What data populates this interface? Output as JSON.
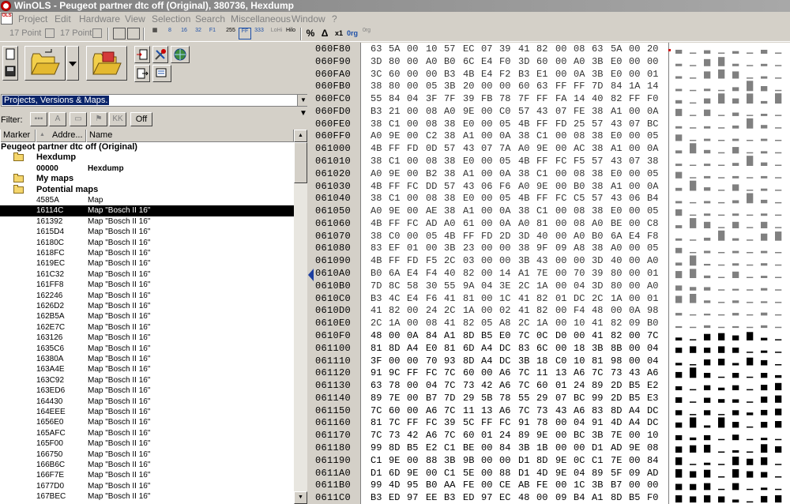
{
  "window": {
    "title": "WinOLS - Peugeot partner dtc off (Original), 380736, Hexdump"
  },
  "menu": [
    "Project",
    "Edit",
    "Hardware",
    "View",
    "Selection",
    "Search",
    "Miscellaneous",
    "Window",
    "?"
  ],
  "toolbar": {
    "point_a": "17 Point",
    "point_b": "17 Point",
    "labels": [
      "8",
      "16",
      "32",
      "F1",
      "255",
      "FF",
      "333",
      "LoHi",
      "Hilo",
      "%",
      "Δ",
      "x1",
      "0rg",
      "0rg"
    ]
  },
  "combo": {
    "value": "Projects, Versions & Maps."
  },
  "filter": {
    "label": "Filter:",
    "off_label": "Off"
  },
  "columns": [
    "Marker",
    "Addre...",
    "Name"
  ],
  "tree": [
    {
      "label": "Peugeot partner dtc off (Original)",
      "kind": "root"
    },
    {
      "label": "Hexdump",
      "kind": "folder"
    },
    {
      "addr": "00000",
      "name": "Hexdump",
      "kind": "boldleaf"
    },
    {
      "label": "My maps",
      "kind": "folder"
    },
    {
      "label": "Potential maps",
      "kind": "folder"
    },
    {
      "addr": "4585A",
      "name": "Map",
      "kind": "leaf"
    },
    {
      "addr": "16114C",
      "name": "Map \"Bosch II 16\"",
      "kind": "leaf",
      "selected": true
    },
    {
      "addr": "161392",
      "name": "Map \"Bosch II 16\"",
      "kind": "leaf"
    },
    {
      "addr": "1615D4",
      "name": "Map \"Bosch II 16\"",
      "kind": "leaf"
    },
    {
      "addr": "16180C",
      "name": "Map \"Bosch II 16\"",
      "kind": "leaf"
    },
    {
      "addr": "1618FC",
      "name": "Map \"Bosch II 16\"",
      "kind": "leaf"
    },
    {
      "addr": "1619EC",
      "name": "Map \"Bosch II 16\"",
      "kind": "leaf"
    },
    {
      "addr": "161C32",
      "name": "Map \"Bosch II 16\"",
      "kind": "leaf"
    },
    {
      "addr": "161FF8",
      "name": "Map \"Bosch II 16\"",
      "kind": "leaf"
    },
    {
      "addr": "162246",
      "name": "Map \"Bosch II 16\"",
      "kind": "leaf"
    },
    {
      "addr": "1626D2",
      "name": "Map \"Bosch II 16\"",
      "kind": "leaf"
    },
    {
      "addr": "162B5A",
      "name": "Map \"Bosch II 16\"",
      "kind": "leaf"
    },
    {
      "addr": "162E7C",
      "name": "Map \"Bosch II 16\"",
      "kind": "leaf"
    },
    {
      "addr": "163126",
      "name": "Map \"Bosch II 16\"",
      "kind": "leaf"
    },
    {
      "addr": "1635C6",
      "name": "Map \"Bosch II 16\"",
      "kind": "leaf"
    },
    {
      "addr": "16380A",
      "name": "Map \"Bosch II 16\"",
      "kind": "leaf"
    },
    {
      "addr": "163A4E",
      "name": "Map \"Bosch II 16\"",
      "kind": "leaf"
    },
    {
      "addr": "163C92",
      "name": "Map \"Bosch II 16\"",
      "kind": "leaf"
    },
    {
      "addr": "163ED6",
      "name": "Map \"Bosch II 16\"",
      "kind": "leaf"
    },
    {
      "addr": "164430",
      "name": "Map \"Bosch II 16\"",
      "kind": "leaf"
    },
    {
      "addr": "164EEE",
      "name": "Map \"Bosch II 16\"",
      "kind": "leaf"
    },
    {
      "addr": "1656E0",
      "name": "Map \"Bosch II 16\"",
      "kind": "leaf"
    },
    {
      "addr": "165AFC",
      "name": "Map \"Bosch II 16\"",
      "kind": "leaf"
    },
    {
      "addr": "165F00",
      "name": "Map \"Bosch II 16\"",
      "kind": "leaf"
    },
    {
      "addr": "166750",
      "name": "Map \"Bosch II 16\"",
      "kind": "leaf"
    },
    {
      "addr": "166B6C",
      "name": "Map \"Bosch II 16\"",
      "kind": "leaf"
    },
    {
      "addr": "166F7E",
      "name": "Map \"Bosch II 16\"",
      "kind": "leaf"
    },
    {
      "addr": "1677D0",
      "name": "Map \"Bosch II 16\"",
      "kind": "leaf"
    },
    {
      "addr": "167BEC",
      "name": "Map \"Bosch II 16\"",
      "kind": "leaf"
    }
  ],
  "hex": [
    {
      "addr": "060F80",
      "bytes": [
        "63",
        "5A",
        "00",
        "10",
        "57",
        "EC",
        "07",
        "39",
        "41",
        "82",
        "00",
        "08",
        "63",
        "5A",
        "00",
        "20"
      ]
    },
    {
      "addr": "060F90",
      "bytes": [
        "3D",
        "80",
        "00",
        "A0",
        "B0",
        "6C",
        "E4",
        "F0",
        "3D",
        "60",
        "00",
        "A0",
        "3B",
        "E0",
        "00",
        "00"
      ]
    },
    {
      "addr": "060FA0",
      "bytes": [
        "3C",
        "60",
        "00",
        "00",
        "B3",
        "4B",
        "E4",
        "F2",
        "B3",
        "E1",
        "00",
        "0A",
        "3B",
        "E0",
        "00",
        "01"
      ]
    },
    {
      "addr": "060FB0",
      "bytes": [
        "38",
        "80",
        "00",
        "05",
        "3B",
        "20",
        "00",
        "00",
        "60",
        "63",
        "FF",
        "FF",
        "7D",
        "84",
        "1A",
        "14"
      ]
    },
    {
      "addr": "060FC0",
      "bytes": [
        "55",
        "84",
        "04",
        "3F",
        "7F",
        "39",
        "FB",
        "78",
        "7F",
        "FF",
        "FA",
        "14",
        "40",
        "82",
        "FF",
        "F0"
      ]
    },
    {
      "addr": "060FD0",
      "bytes": [
        "B3",
        "21",
        "00",
        "08",
        "A0",
        "9E",
        "00",
        "C0",
        "57",
        "43",
        "07",
        "FE",
        "38",
        "A1",
        "00",
        "0A"
      ]
    },
    {
      "addr": "060FE0",
      "bytes": [
        "38",
        "C1",
        "00",
        "08",
        "38",
        "E0",
        "00",
        "05",
        "4B",
        "FF",
        "FD",
        "25",
        "57",
        "43",
        "07",
        "BC"
      ]
    },
    {
      "addr": "060FF0",
      "bytes": [
        "A0",
        "9E",
        "00",
        "C2",
        "38",
        "A1",
        "00",
        "0A",
        "38",
        "C1",
        "00",
        "08",
        "38",
        "E0",
        "00",
        "05"
      ]
    },
    {
      "addr": "061000",
      "bytes": [
        "4B",
        "FF",
        "FD",
        "0D",
        "57",
        "43",
        "07",
        "7A",
        "A0",
        "9E",
        "00",
        "AC",
        "38",
        "A1",
        "00",
        "0A"
      ]
    },
    {
      "addr": "061010",
      "bytes": [
        "38",
        "C1",
        "00",
        "08",
        "38",
        "E0",
        "00",
        "05",
        "4B",
        "FF",
        "FC",
        "F5",
        "57",
        "43",
        "07",
        "38"
      ]
    },
    {
      "addr": "061020",
      "bytes": [
        "A0",
        "9E",
        "00",
        "B2",
        "38",
        "A1",
        "00",
        "0A",
        "38",
        "C1",
        "00",
        "08",
        "38",
        "E0",
        "00",
        "05"
      ]
    },
    {
      "addr": "061030",
      "bytes": [
        "4B",
        "FF",
        "FC",
        "DD",
        "57",
        "43",
        "06",
        "F6",
        "A0",
        "9E",
        "00",
        "B0",
        "38",
        "A1",
        "00",
        "0A"
      ]
    },
    {
      "addr": "061040",
      "bytes": [
        "38",
        "C1",
        "00",
        "08",
        "38",
        "E0",
        "00",
        "05",
        "4B",
        "FF",
        "FC",
        "C5",
        "57",
        "43",
        "06",
        "B4"
      ]
    },
    {
      "addr": "061050",
      "bytes": [
        "A0",
        "9E",
        "00",
        "AE",
        "38",
        "A1",
        "00",
        "0A",
        "38",
        "C1",
        "00",
        "08",
        "38",
        "E0",
        "00",
        "05"
      ]
    },
    {
      "addr": "061060",
      "bytes": [
        "4B",
        "FF",
        "FC",
        "AD",
        "A0",
        "61",
        "00",
        "0A",
        "A0",
        "81",
        "00",
        "08",
        "A0",
        "BE",
        "00",
        "C8"
      ]
    },
    {
      "addr": "061070",
      "bytes": [
        "38",
        "C0",
        "00",
        "05",
        "4B",
        "FF",
        "FD",
        "2D",
        "3D",
        "40",
        "00",
        "A0",
        "B0",
        "6A",
        "E4",
        "F8"
      ]
    },
    {
      "addr": "061080",
      "bytes": [
        "83",
        "EF",
        "01",
        "00",
        "3B",
        "23",
        "00",
        "00",
        "38",
        "9F",
        "09",
        "A8",
        "38",
        "A0",
        "00",
        "05"
      ]
    },
    {
      "addr": "061090",
      "bytes": [
        "4B",
        "FF",
        "FD",
        "F5",
        "2C",
        "03",
        "00",
        "00",
        "3B",
        "43",
        "00",
        "00",
        "3D",
        "40",
        "00",
        "A0"
      ]
    },
    {
      "addr": "0610A0",
      "bytes": [
        "B0",
        "6A",
        "E4",
        "F4",
        "40",
        "82",
        "00",
        "14",
        "A1",
        "7E",
        "00",
        "70",
        "39",
        "80",
        "00",
        "01"
      ]
    },
    {
      "addr": "0610B0",
      "bytes": [
        "7D",
        "8C",
        "58",
        "30",
        "55",
        "9A",
        "04",
        "3E",
        "2C",
        "1A",
        "00",
        "04",
        "3D",
        "80",
        "00",
        "A0"
      ]
    },
    {
      "addr": "0610C0",
      "bytes": [
        "B3",
        "4C",
        "E4",
        "F6",
        "41",
        "81",
        "00",
        "1C",
        "41",
        "82",
        "01",
        "DC",
        "2C",
        "1A",
        "00",
        "01"
      ]
    },
    {
      "addr": "0610D0",
      "bytes": [
        "41",
        "82",
        "00",
        "24",
        "2C",
        "1A",
        "00",
        "02",
        "41",
        "82",
        "00",
        "F4",
        "48",
        "00",
        "0A",
        "98"
      ]
    },
    {
      "addr": "0610E0",
      "bytes": [
        "2C",
        "1A",
        "00",
        "08",
        "41",
        "82",
        "05",
        "A8",
        "2C",
        "1A",
        "00",
        "10",
        "41",
        "82",
        "09",
        "B0"
      ]
    },
    {
      "addr": "0610F0",
      "bytes": [
        "48",
        "00",
        "0A",
        "84",
        "A1",
        "8D",
        "B5",
        "E0",
        "7C",
        "0C",
        "D0",
        "00",
        "41",
        "82",
        "00",
        "7C"
      ]
    },
    {
      "addr": "061100",
      "bytes": [
        "81",
        "8D",
        "A4",
        "E0",
        "81",
        "6D",
        "A4",
        "DC",
        "83",
        "6C",
        "00",
        "18",
        "3B",
        "8B",
        "00",
        "04"
      ]
    },
    {
      "addr": "061110",
      "bytes": [
        "3F",
        "00",
        "00",
        "70",
        "93",
        "8D",
        "A4",
        "DC",
        "3B",
        "18",
        "C0",
        "10",
        "81",
        "98",
        "00",
        "04"
      ]
    },
    {
      "addr": "061120",
      "bytes": [
        "91",
        "9C",
        "FF",
        "FC",
        "7C",
        "60",
        "00",
        "A6",
        "7C",
        "11",
        "13",
        "A6",
        "7C",
        "73",
        "43",
        "A6"
      ]
    },
    {
      "addr": "061130",
      "bytes": [
        "63",
        "78",
        "00",
        "04",
        "7C",
        "73",
        "42",
        "A6",
        "7C",
        "60",
        "01",
        "24",
        "89",
        "2D",
        "B5",
        "E2"
      ]
    },
    {
      "addr": "061140",
      "bytes": [
        "89",
        "7E",
        "00",
        "B7",
        "7D",
        "29",
        "5B",
        "78",
        "55",
        "29",
        "07",
        "BC",
        "99",
        "2D",
        "B5",
        "E3"
      ]
    },
    {
      "addr": "061150",
      "bytes": [
        "7C",
        "60",
        "00",
        "A6",
        "7C",
        "11",
        "13",
        "A6",
        "7C",
        "73",
        "43",
        "A6",
        "83",
        "8D",
        "A4",
        "DC"
      ]
    },
    {
      "addr": "061160",
      "bytes": [
        "81",
        "7C",
        "FF",
        "FC",
        "39",
        "5C",
        "FF",
        "FC",
        "91",
        "78",
        "00",
        "04",
        "91",
        "4D",
        "A4",
        "DC"
      ]
    },
    {
      "addr": "061170",
      "bytes": [
        "7C",
        "73",
        "42",
        "A6",
        "7C",
        "60",
        "01",
        "24",
        "89",
        "9E",
        "00",
        "BC",
        "3B",
        "7E",
        "00",
        "10"
      ]
    },
    {
      "addr": "061180",
      "bytes": [
        "99",
        "8D",
        "B5",
        "E2",
        "C1",
        "BE",
        "00",
        "84",
        "3B",
        "1B",
        "00",
        "00",
        "D1",
        "AD",
        "9E",
        "08"
      ]
    },
    {
      "addr": "061190",
      "bytes": [
        "C1",
        "9E",
        "00",
        "88",
        "3B",
        "9B",
        "00",
        "00",
        "D1",
        "8D",
        "9E",
        "0C",
        "C1",
        "7E",
        "00",
        "84"
      ]
    },
    {
      "addr": "0611A0",
      "bytes": [
        "D1",
        "6D",
        "9E",
        "00",
        "C1",
        "5E",
        "00",
        "88",
        "D1",
        "4D",
        "9E",
        "04",
        "89",
        "5F",
        "09",
        "AD"
      ]
    },
    {
      "addr": "0611B0",
      "bytes": [
        "99",
        "4D",
        "95",
        "B0",
        "AA",
        "FE",
        "00",
        "CE",
        "AB",
        "FE",
        "00",
        "1C",
        "3B",
        "B7",
        "00",
        "00"
      ]
    },
    {
      "addr": "0611C0",
      "bytes": [
        "B3",
        "ED",
        "97",
        "EE",
        "B3",
        "ED",
        "97",
        "EC",
        "48",
        "00",
        "09",
        "B4",
        "A1",
        "8D",
        "B5",
        "F0"
      ]
    }
  ],
  "colors": {
    "selected_row": "#000000",
    "combo_highlight": "#0a246a",
    "splitter_arrow": "#1c3ea0",
    "graph_light": "#808080",
    "graph_dark": "#000000"
  }
}
